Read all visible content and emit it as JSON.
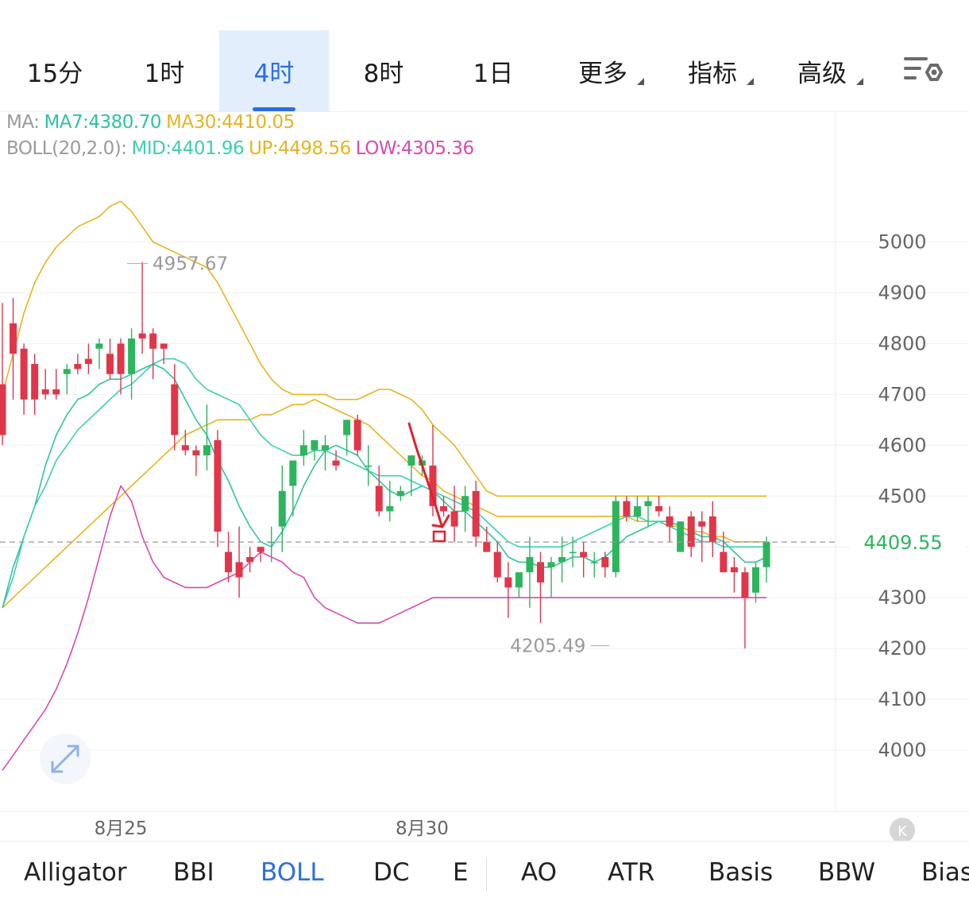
{
  "tabs": {
    "t15m": "15分",
    "t1h": "1时",
    "t4h": "4时",
    "t8h": "8时",
    "t1d": "1日",
    "more": "更多",
    "indicators": "指标",
    "advanced": "高级"
  },
  "legend": {
    "ma_prefix": "MA:",
    "ma7": "MA7:4380.70",
    "ma30": "MA30:4410.05",
    "boll_prefix": "BOLL(20,2.0):",
    "mid": "MID:4401.96",
    "up": "UP:4498.56",
    "low": "LOW:4305.36"
  },
  "indicator_tabs": [
    "Alligator",
    "BBI",
    "BOLL",
    "DC",
    "E",
    "AO",
    "ATR",
    "Basis",
    "BBW",
    "Bias"
  ],
  "colors": {
    "up": "#2db55d",
    "down": "#e0364a",
    "ma7": "#2ec4a0",
    "ma30": "#e6b422",
    "boll_mid": "#3ecfb0",
    "boll_up": "#e6b422",
    "boll_low": "#d64bb4",
    "accent": "#2a6fe0",
    "annotation": "#e02030"
  },
  "chart_data": {
    "type": "candlestick",
    "ylim": [
      3930,
      5130
    ],
    "y_ticks": [
      4000,
      4100,
      4200,
      4300,
      4400,
      4500,
      4600,
      4700,
      4800,
      4900,
      5000
    ],
    "x_labels": [
      {
        "index": 11,
        "label": "8月25"
      },
      {
        "index": 39,
        "label": "8月30"
      }
    ],
    "last_price": 4409.55,
    "max_label": {
      "index": 11,
      "value": 4957.67,
      "text": "4957.67"
    },
    "min_label": {
      "index": 57,
      "value": 4205.49,
      "text": "4205.49"
    },
    "candles": [
      [
        4720,
        4880,
        4600,
        4620
      ],
      [
        4840,
        4890,
        4690,
        4780
      ],
      [
        4790,
        4800,
        4660,
        4690
      ],
      [
        4760,
        4780,
        4660,
        4690
      ],
      [
        4710,
        4750,
        4690,
        4700
      ],
      [
        4710,
        4750,
        4690,
        4700
      ],
      [
        4740,
        4760,
        4700,
        4750
      ],
      [
        4760,
        4780,
        4740,
        4750
      ],
      [
        4770,
        4800,
        4740,
        4760
      ],
      [
        4790,
        4810,
        4750,
        4800
      ],
      [
        4780,
        4810,
        4730,
        4740
      ],
      [
        4800,
        4810,
        4700,
        4740
      ],
      [
        4740,
        4830,
        4690,
        4810
      ],
      [
        4820,
        4960,
        4780,
        4810
      ],
      [
        4820,
        4830,
        4730,
        4790
      ],
      [
        4800,
        4800,
        4760,
        4790
      ],
      [
        4720,
        4760,
        4590,
        4620
      ],
      [
        4600,
        4630,
        4580,
        4590
      ],
      [
        4590,
        4600,
        4540,
        4580
      ],
      [
        4580,
        4680,
        4550,
        4600
      ],
      [
        4610,
        4630,
        4400,
        4430
      ],
      [
        4390,
        4430,
        4330,
        4350
      ],
      [
        4370,
        4440,
        4300,
        4340
      ],
      [
        4380,
        4400,
        4350,
        4370
      ],
      [
        4400,
        4400,
        4370,
        4390
      ],
      [
        4410,
        4440,
        4370,
        4410
      ],
      [
        4440,
        4560,
        4390,
        4510
      ],
      [
        4520,
        4570,
        4460,
        4570
      ],
      [
        4580,
        4630,
        4560,
        4600
      ],
      [
        4590,
        4610,
        4570,
        4610
      ],
      [
        4590,
        4620,
        4550,
        4600
      ],
      [
        4570,
        4590,
        4550,
        4560
      ],
      [
        4620,
        4650,
        4580,
        4650
      ],
      [
        4650,
        4660,
        4580,
        4590
      ],
      [
        4560,
        4600,
        4520,
        4560
      ],
      [
        4520,
        4560,
        4460,
        4470
      ],
      [
        4470,
        4530,
        4450,
        4480
      ],
      [
        4500,
        4520,
        4490,
        4510
      ],
      [
        4560,
        4580,
        4500,
        4580
      ],
      [
        4560,
        4580,
        4540,
        4570
      ],
      [
        4560,
        4640,
        4460,
        4480
      ],
      [
        4480,
        4500,
        4460,
        4470
      ],
      [
        4470,
        4520,
        4410,
        4440
      ],
      [
        4470,
        4520,
        4430,
        4500
      ],
      [
        4510,
        4530,
        4400,
        4420
      ],
      [
        4410,
        4440,
        4390,
        4390
      ],
      [
        4390,
        4410,
        4330,
        4340
      ],
      [
        4340,
        4370,
        4260,
        4320
      ],
      [
        4320,
        4350,
        4300,
        4350
      ],
      [
        4350,
        4420,
        4280,
        4380
      ],
      [
        4370,
        4390,
        4250,
        4330
      ],
      [
        4360,
        4380,
        4300,
        4370
      ],
      [
        4370,
        4420,
        4330,
        4380
      ],
      [
        4390,
        4420,
        4360,
        4390
      ],
      [
        4390,
        4410,
        4340,
        4380
      ],
      [
        4370,
        4390,
        4340,
        4370
      ],
      [
        4380,
        4390,
        4340,
        4360
      ],
      [
        4350,
        4500,
        4340,
        4490
      ],
      [
        4490,
        4500,
        4450,
        4460
      ],
      [
        4460,
        4500,
        4450,
        4480
      ],
      [
        4480,
        4500,
        4440,
        4490
      ],
      [
        4480,
        4500,
        4460,
        4470
      ],
      [
        4460,
        4480,
        4410,
        4440
      ],
      [
        4390,
        4450,
        4390,
        4450
      ],
      [
        4460,
        4470,
        4380,
        4400
      ],
      [
        4450,
        4470,
        4370,
        4440
      ],
      [
        4460,
        4490,
        4380,
        4410
      ],
      [
        4390,
        4430,
        4360,
        4350
      ],
      [
        4360,
        4380,
        4310,
        4350
      ],
      [
        4350,
        4360,
        4200,
        4300
      ],
      [
        4310,
        4370,
        4290,
        4360
      ],
      [
        4360,
        4420,
        4330,
        4410
      ]
    ],
    "series": [
      {
        "key": "ma7",
        "values": [
          4280,
          4360,
          4420,
          4480,
          4560,
          4620,
          4660,
          4690,
          4700,
          4720,
          4730,
          4730,
          4740,
          4750,
          4760,
          4750,
          4730,
          4690,
          4650,
          4620,
          4570,
          4530,
          4480,
          4440,
          4410,
          4400,
          4430,
          4470,
          4520,
          4560,
          4590,
          4600,
          4590,
          4580,
          4550,
          4530,
          4510,
          4500,
          4510,
          4520,
          4510,
          4490,
          4470,
          4470,
          4450,
          4430,
          4410,
          4380,
          4370,
          4370,
          4360,
          4360,
          4370,
          4380,
          4380,
          4370,
          4380,
          4400,
          4420,
          4430,
          4440,
          4450,
          4450,
          4440,
          4430,
          4420,
          4420,
          4410,
          4390,
          4370,
          4370,
          4380
        ]
      },
      {
        "key": "ma30",
        "values": [
          4280,
          4300,
          4320,
          4340,
          4360,
          4380,
          4400,
          4420,
          4440,
          4460,
          4480,
          4500,
          4520,
          4540,
          4560,
          4580,
          4600,
          4620,
          4630,
          4640,
          4650,
          4650,
          4650,
          4650,
          4660,
          4660,
          4670,
          4680,
          4680,
          4690,
          4680,
          4670,
          4660,
          4650,
          4640,
          4620,
          4600,
          4580,
          4560,
          4540,
          4530,
          4510,
          4500,
          4490,
          4480,
          4470,
          4460,
          4460,
          4460,
          4460,
          4460,
          4460,
          4460,
          4460,
          4460,
          4460,
          4460,
          4460,
          4460,
          4450,
          4450,
          4450,
          4440,
          4440,
          4430,
          4430,
          4420,
          4420,
          4410,
          4410,
          4410,
          4410
        ]
      },
      {
        "key": "boll_mid",
        "values": [
          4280,
          4340,
          4420,
          4480,
          4520,
          4570,
          4600,
          4630,
          4650,
          4670,
          4690,
          4710,
          4720,
          4740,
          4760,
          4770,
          4770,
          4760,
          4730,
          4710,
          4700,
          4690,
          4680,
          4650,
          4620,
          4600,
          4590,
          4580,
          4580,
          4590,
          4590,
          4580,
          4570,
          4560,
          4550,
          4540,
          4540,
          4540,
          4530,
          4520,
          4510,
          4500,
          4490,
          4480,
          4470,
          4450,
          4430,
          4410,
          4400,
          4400,
          4400,
          4400,
          4400,
          4410,
          4420,
          4430,
          4440,
          4450,
          4460,
          4460,
          4450,
          4450,
          4440,
          4430,
          4420,
          4410,
          4410,
          4400,
          4400,
          4400,
          4400,
          4400
        ]
      },
      {
        "key": "boll_up",
        "values": [
          4700,
          4780,
          4860,
          4920,
          4960,
          4990,
          5010,
          5030,
          5040,
          5050,
          5070,
          5080,
          5060,
          5030,
          5000,
          4990,
          4980,
          4970,
          4960,
          4950,
          4920,
          4880,
          4840,
          4800,
          4760,
          4730,
          4710,
          4700,
          4700,
          4700,
          4700,
          4690,
          4690,
          4690,
          4700,
          4710,
          4710,
          4700,
          4690,
          4670,
          4640,
          4620,
          4600,
          4570,
          4540,
          4510,
          4500,
          4500,
          4500,
          4500,
          4500,
          4500,
          4500,
          4500,
          4500,
          4500,
          4500,
          4500,
          4500,
          4500,
          4500,
          4500,
          4500,
          4500,
          4500,
          4500,
          4500,
          4500,
          4500,
          4500,
          4500,
          4500
        ]
      },
      {
        "key": "boll_low",
        "values": [
          3960,
          3990,
          4020,
          4050,
          4080,
          4120,
          4170,
          4230,
          4300,
          4380,
          4460,
          4520,
          4490,
          4420,
          4370,
          4340,
          4330,
          4320,
          4320,
          4320,
          4330,
          4340,
          4350,
          4370,
          4390,
          4380,
          4370,
          4350,
          4340,
          4300,
          4280,
          4270,
          4260,
          4250,
          4250,
          4250,
          4260,
          4270,
          4280,
          4290,
          4300,
          4300,
          4300,
          4300,
          4300,
          4300,
          4300,
          4300,
          4300,
          4300,
          4300,
          4300,
          4300,
          4300,
          4300,
          4300,
          4300,
          4300,
          4300,
          4300,
          4300,
          4300,
          4300,
          4300,
          4300,
          4300,
          4300,
          4300,
          4300,
          4300,
          4300,
          4300
        ]
      }
    ]
  }
}
